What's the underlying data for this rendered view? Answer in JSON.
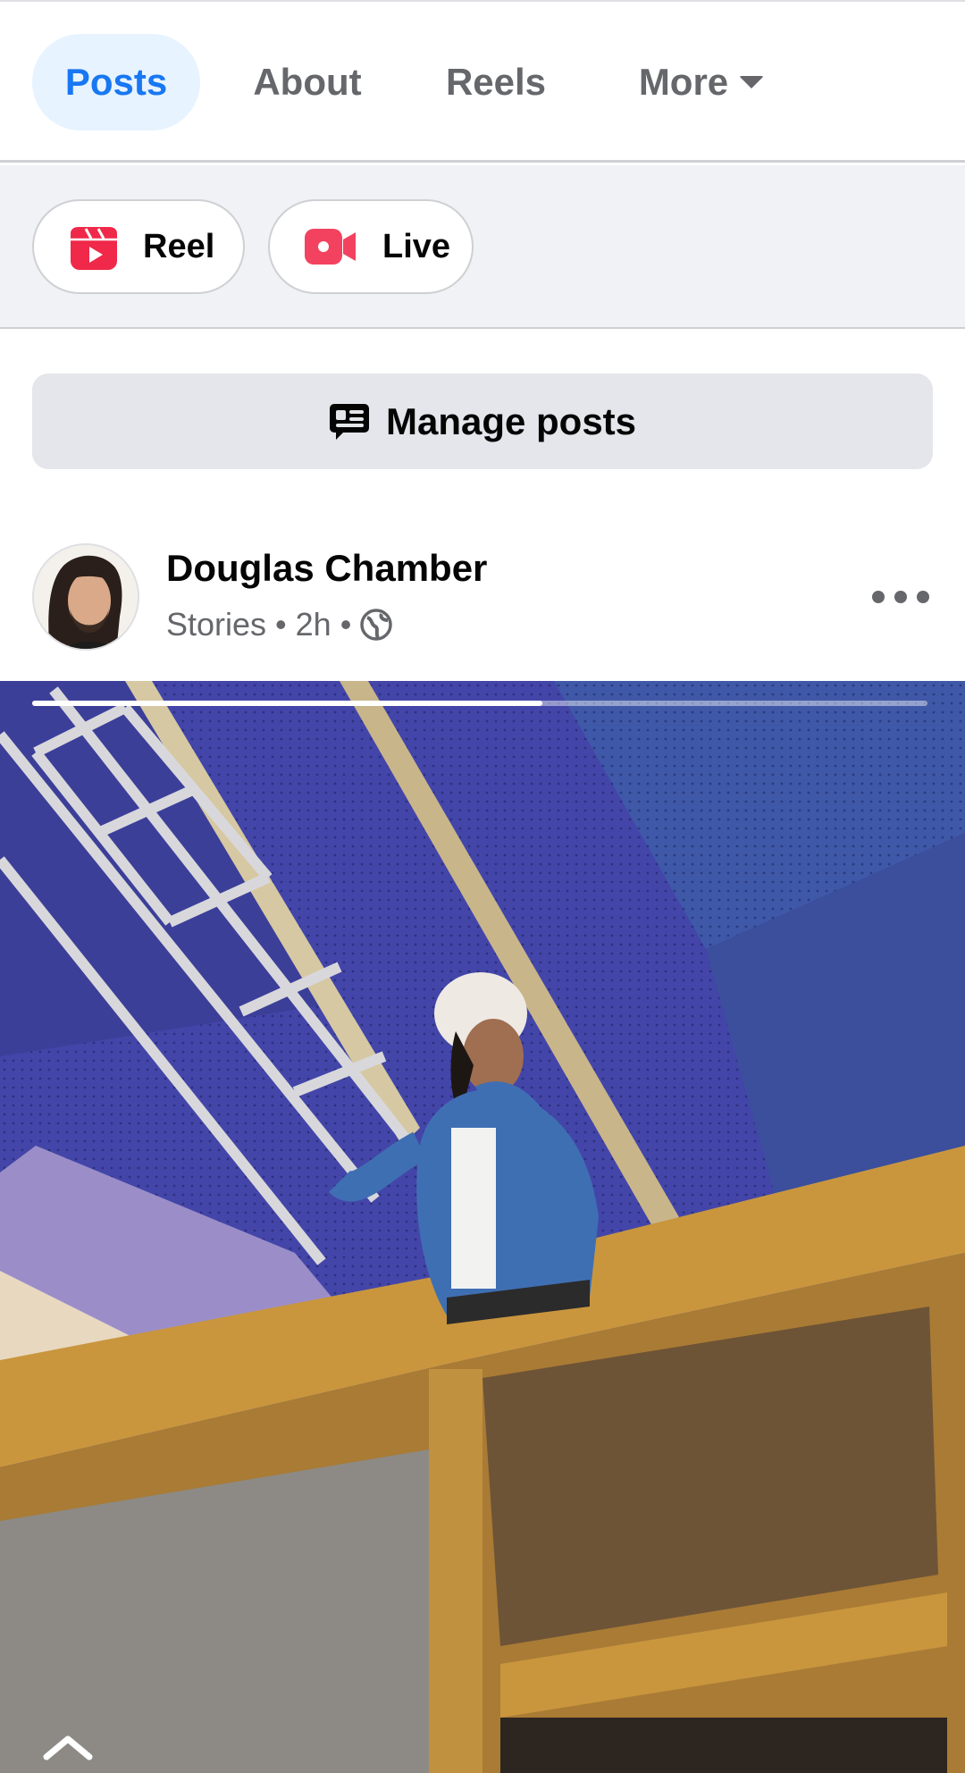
{
  "tabs": [
    {
      "label": "Posts",
      "active": true
    },
    {
      "label": "About",
      "active": false
    },
    {
      "label": "Reels",
      "active": false
    },
    {
      "label": "More",
      "active": false
    }
  ],
  "create": {
    "reel_label": "Reel",
    "live_label": "Live"
  },
  "manage": {
    "label": "Manage posts"
  },
  "post": {
    "author": "Douglas Chamber",
    "source": "Stories",
    "time": "2h",
    "separator": "•",
    "audience_icon": "globe-icon",
    "story_progress": 0.57
  },
  "colors": {
    "accent": "#1877f2",
    "reel_red": "#f02849",
    "live_red": "#f3425f"
  }
}
